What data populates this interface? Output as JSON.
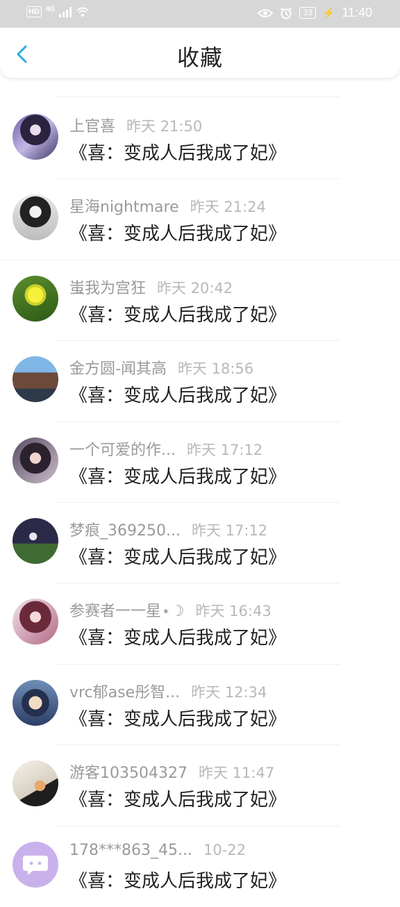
{
  "status_bar": {
    "left_badge": "HD",
    "network": "4G",
    "battery": "33",
    "time": "11:40"
  },
  "header": {
    "title": "收藏"
  },
  "items": [
    {
      "name": "上官喜",
      "time": "昨天 21:50",
      "book": "《喜：变成人后我成了妃》"
    },
    {
      "name": "星海nightmare",
      "time": "昨天 21:24",
      "book": "《喜：变成人后我成了妃》"
    },
    {
      "name": "蚩我为宫狂",
      "time": "昨天 20:42",
      "book": "《喜：变成人后我成了妃》"
    },
    {
      "name": "金方圆-闻其高",
      "time": "昨天 18:56",
      "book": "《喜：变成人后我成了妃》"
    },
    {
      "name": "一个可爱的作...",
      "time": "昨天 17:12",
      "book": "《喜：变成人后我成了妃》"
    },
    {
      "name": "梦痕_369250...",
      "time": "昨天 17:12",
      "book": "《喜：变成人后我成了妃》"
    },
    {
      "name": "参赛者一一星⋆☽",
      "time": "昨天 16:43",
      "book": "《喜：变成人后我成了妃》"
    },
    {
      "name": "vrc郁ase彤智...",
      "time": "昨天 12:34",
      "book": "《喜：变成人后我成了妃》"
    },
    {
      "name": "游客103504327",
      "time": "昨天 11:47",
      "book": "《喜：变成人后我成了妃》"
    },
    {
      "name": "178***863_45...",
      "time": "10-22",
      "book": "《喜：变成人后我成了妃》"
    }
  ],
  "colors": {
    "accent": "#2aa9e8",
    "status_bar_bg": "#d7d7d7",
    "name_text": "#9a9a9a",
    "time_text": "#b8b8b8"
  }
}
